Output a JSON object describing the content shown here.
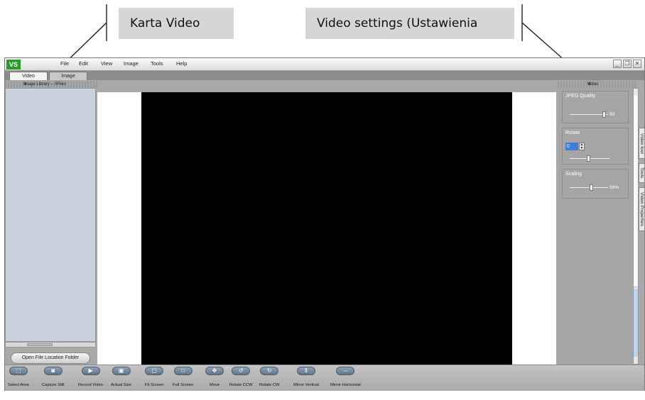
{
  "callouts": {
    "video_tab": "Karta Video",
    "video_settings": "Video settings (Ustawienia"
  },
  "app": {
    "logo": "VS"
  },
  "menu": [
    "File",
    "Edit",
    "View",
    "Image",
    "Tools",
    "Help"
  ],
  "window_buttons": {
    "minimize": "_",
    "restore": "❐",
    "close": "✕"
  },
  "tabs": [
    "Video",
    "Image"
  ],
  "library": {
    "title": "Image Library -- 0Files",
    "open_folder": "Open File Location Folder"
  },
  "video_panel": {
    "title": "Video",
    "jpeg_quality": {
      "label": "JPEG Quality",
      "value": "90",
      "level": 0.9
    },
    "rotate": {
      "label": "Rotate",
      "value": "0"
    },
    "scaling": {
      "label": "Scaling",
      "value": "58%",
      "level": 0.58
    }
  },
  "side_tabs": [
    "Video tool",
    "Tools",
    "Video Properties"
  ],
  "toolbar": [
    {
      "label": "Select Area",
      "icon": "select-area-icon",
      "glyph": "⬚"
    },
    {
      "label": "Capture Still",
      "icon": "camera-icon",
      "glyph": "◙"
    },
    {
      "label": "Record Video",
      "icon": "record-icon",
      "glyph": "▶"
    },
    {
      "label": "Actual Size",
      "icon": "actual-size-icon",
      "glyph": "▣"
    },
    {
      "label": "Fit Screen",
      "icon": "fit-screen-icon",
      "glyph": "▢"
    },
    {
      "label": "Full Screen",
      "icon": "full-screen-icon",
      "glyph": "□"
    },
    {
      "label": "Move",
      "icon": "move-icon",
      "glyph": "✥"
    },
    {
      "label": "Rotate CCW",
      "icon": "rotate-ccw-icon",
      "glyph": "↺"
    },
    {
      "label": "Rotate CW",
      "icon": "rotate-cw-icon",
      "glyph": "↻"
    },
    {
      "label": "Mirror Vertical",
      "icon": "mirror-vertical-icon",
      "glyph": "⇕"
    },
    {
      "label": "Mirror Horizontal",
      "icon": "mirror-horizontal-icon",
      "glyph": "⇔"
    }
  ]
}
